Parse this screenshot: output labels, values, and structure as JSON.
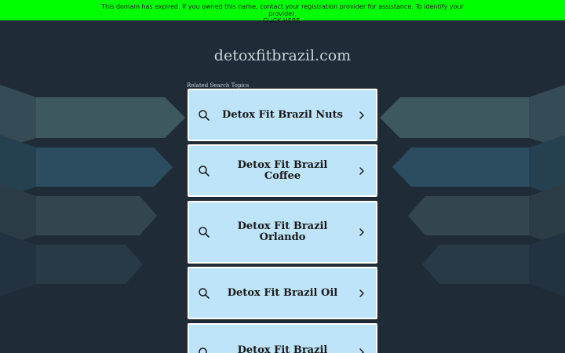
{
  "banner": {
    "message": "This domain has expired. If you owned this name, contact your registration provider for assistance. To identify your provider,",
    "link_label": "CLICK HERE."
  },
  "domain": "detoxfitbrazil.com",
  "related_label": "Related Search Topics",
  "topics": [
    {
      "label": "Detox Fit Brazil Nuts"
    },
    {
      "label": "Detox Fit Brazil Coffee"
    },
    {
      "label": "Detox Fit Brazil Orlando"
    },
    {
      "label": "Detox Fit Brazil Oil"
    },
    {
      "label": "Detox Fit Brazil"
    }
  ],
  "colors": {
    "banner_bg": "#00ff00",
    "page_bg": "#1f2b36",
    "card_bg": "#bde4f8"
  },
  "icons": {
    "search": "search-icon",
    "chevron": "chevron-right-icon"
  }
}
